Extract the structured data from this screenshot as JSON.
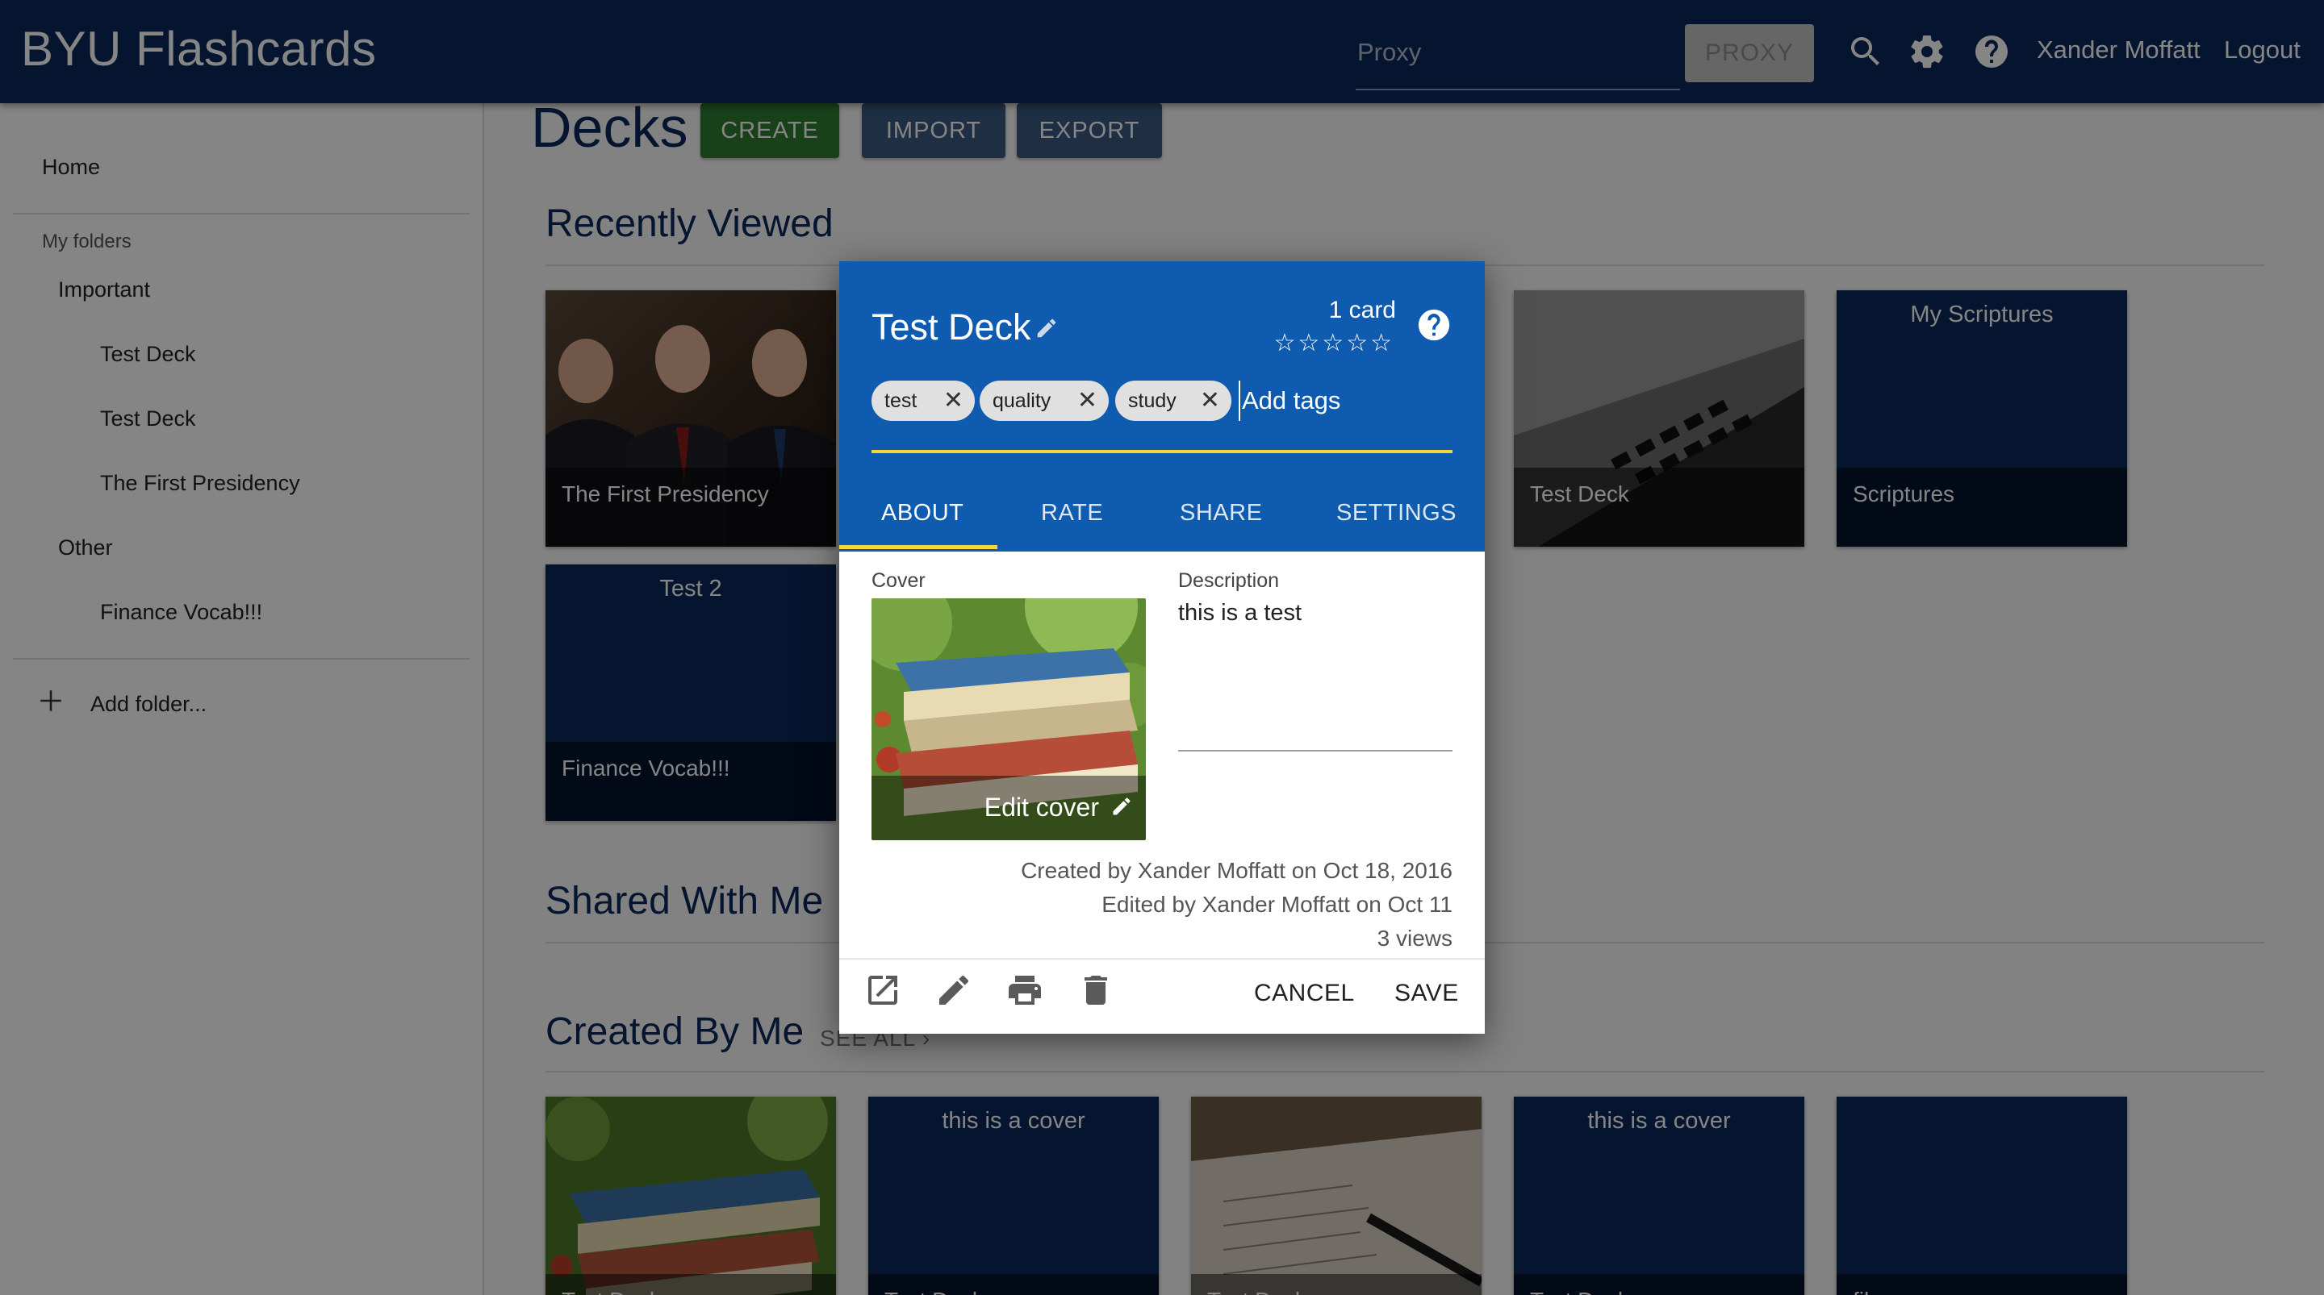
{
  "header": {
    "app_title": "BYU Flashcards",
    "proxy_placeholder": "Proxy",
    "proxy_button": "PROXY",
    "user_name": "Xander Moffatt",
    "logout": "Logout",
    "icons": [
      "search-icon",
      "gear-icon",
      "help-icon"
    ]
  },
  "sidebar": {
    "home": "Home",
    "my_folders": "My folders",
    "folders": [
      {
        "label": "Important",
        "items": [
          "Test Deck",
          "Test Deck",
          "The First Presidency"
        ]
      },
      {
        "label": "Other",
        "items": [
          "Finance Vocab!!!"
        ]
      }
    ],
    "add_folder": "Add folder..."
  },
  "main": {
    "title": "Decks",
    "buttons": {
      "create": "CREATE",
      "import": "IMPORT",
      "export": "EXPORT"
    },
    "recently_viewed": {
      "title": "Recently Viewed",
      "cards": [
        {
          "foot": "The First Presidency",
          "title": ""
        },
        {
          "foot": "Test Deck",
          "title": ""
        },
        {
          "foot": "Scriptures",
          "title": "My Scriptures"
        },
        {
          "foot": "Finance Vocab!!!",
          "title": "Test 2"
        }
      ]
    },
    "shared_with_me": {
      "title": "Shared With Me"
    },
    "created_by_me": {
      "title": "Created By Me",
      "see_all": "SEE ALL ›",
      "cards": [
        {
          "title": "",
          "foot": "Test Deck"
        },
        {
          "title": "this is a cover",
          "foot": "Test Deck"
        },
        {
          "title": "",
          "foot": "Test Deck"
        },
        {
          "title": "this is a cover",
          "foot": "Test Deck"
        },
        {
          "title": "",
          "foot": "files"
        }
      ]
    }
  },
  "dialog": {
    "title": "Test Deck",
    "card_count": "1 card",
    "stars": "☆☆☆☆☆",
    "tags": [
      "test",
      "quality",
      "study"
    ],
    "add_tags_placeholder": "Add tags",
    "tabs": [
      "ABOUT",
      "RATE",
      "SHARE",
      "SETTINGS"
    ],
    "active_tab": "ABOUT",
    "cover_label": "Cover",
    "edit_cover": "Edit cover",
    "description_label": "Description",
    "description": "this is a test",
    "created": "Created by Xander Moffatt on Oct 18, 2016",
    "edited": "Edited by Xander Moffatt on Oct 11",
    "views": "3 views",
    "cancel": "CANCEL",
    "save": "SAVE",
    "colors": {
      "header": "#0e5bb0",
      "accent": "#f3d63f",
      "navy": "#0d2a5a",
      "create_btn": "#2e7d32",
      "secondary_btn": "#3a5a80"
    }
  }
}
